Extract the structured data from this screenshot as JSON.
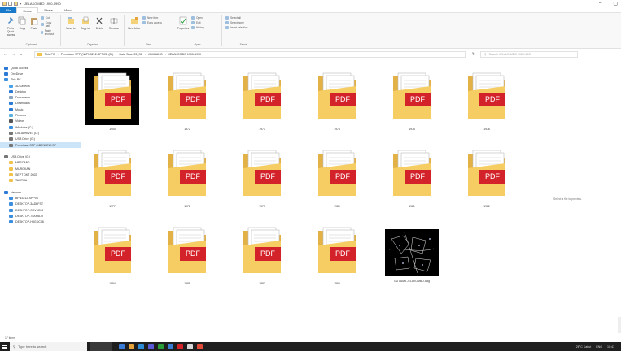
{
  "window": {
    "title": "JELAKOMBO 1900-1990",
    "minimize": "–",
    "maximize": "▢"
  },
  "ribbon_tabs": [
    "File",
    "Home",
    "Share",
    "View"
  ],
  "ribbon": {
    "clipboard": {
      "pin": "Pin to Quick access",
      "copy": "Copy",
      "paste": "Paste",
      "cut": "Cut",
      "copy_path": "Copy path",
      "paste_shortcut": "Paste shortcut",
      "group": "Clipboard"
    },
    "organize": {
      "move_to": "Move to",
      "copy_to": "Copy to",
      "delete": "Delete",
      "rename": "Rename",
      "group": "Organize"
    },
    "new": {
      "new_folder": "New folder",
      "new_item": "New item",
      "easy_access": "Easy access",
      "group": "New"
    },
    "open": {
      "properties": "Properties",
      "open": "Open",
      "edit": "Edit",
      "history": "History",
      "group": "Open"
    },
    "select": {
      "select_all": "Select all",
      "select_none": "Select none",
      "invert": "Invert selection",
      "group": "Select"
    }
  },
  "address": {
    "path": [
      "This PC",
      "Pemetaan SPP (\\\\BPN3212-SPP03) (D:)",
      "Data Scan 03_S8",
      "JOMBANG",
      "JELAKOMBO 1900-1990"
    ],
    "search_placeholder": "Search JELAKOMBO 1900-1990"
  },
  "nav_items": [
    {
      "label": "Quick access",
      "icon": "star-icon",
      "color": "#2d7ad6",
      "indent": 0
    },
    {
      "label": "OneDrive",
      "icon": "cloud-icon",
      "color": "#2d7ad6",
      "indent": 0
    },
    {
      "label": "This PC",
      "icon": "computer-icon",
      "color": "#3c8ede",
      "indent": 0
    },
    {
      "label": "3D Objects",
      "icon": "cube-icon",
      "color": "#4aa3e8",
      "indent": 1
    },
    {
      "label": "Desktop",
      "icon": "desktop-icon",
      "color": "#2d7ad6",
      "indent": 1
    },
    {
      "label": "Documents",
      "icon": "document-icon",
      "color": "#8aa4c0",
      "indent": 1
    },
    {
      "label": "Downloads",
      "icon": "download-icon",
      "color": "#2d7ad6",
      "indent": 1
    },
    {
      "label": "Music",
      "icon": "music-icon",
      "color": "#2d7ad6",
      "indent": 1
    },
    {
      "label": "Pictures",
      "icon": "picture-icon",
      "color": "#5ab0e0",
      "indent": 1
    },
    {
      "label": "Videos",
      "icon": "video-icon",
      "color": "#555555",
      "indent": 1
    },
    {
      "label": "Windows (C:)",
      "icon": "drive-icon",
      "color": "#3c8ede",
      "indent": 1
    },
    {
      "label": "DATADRIVE1 (D:)",
      "icon": "drive-icon",
      "color": "#777777",
      "indent": 1
    },
    {
      "label": "USB Drive (G:)",
      "icon": "usb-icon",
      "color": "#777777",
      "indent": 1
    },
    {
      "label": "Pemetaan SPP (\\\\BPN3212-SP",
      "icon": "network-drive-icon",
      "color": "#777777",
      "indent": 1
    },
    {
      "label": "",
      "icon": "",
      "color": "",
      "indent": 0
    },
    {
      "label": "USB Drive (G:)",
      "icon": "usb-icon",
      "color": "#777777",
      "indent": 0
    },
    {
      "label": "MPSCAN0",
      "icon": "folder-icon",
      "color": "#f1c34a",
      "indent": 1
    },
    {
      "label": "MURGKAN",
      "icon": "folder-icon",
      "color": "#f1c34a",
      "indent": 1
    },
    {
      "label": "SEPT DKT 2022",
      "icon": "folder-icon",
      "color": "#f1c34a",
      "indent": 1
    },
    {
      "label": "TAUTHA",
      "icon": "folder-icon",
      "color": "#f1c34a",
      "indent": 1
    },
    {
      "label": "",
      "icon": "",
      "color": "",
      "indent": 0
    },
    {
      "label": "Network",
      "icon": "network-icon",
      "color": "#2d7ad6",
      "indent": 0
    },
    {
      "label": "BPN3212-SPP03",
      "icon": "computer-icon",
      "color": "#3c8ede",
      "indent": 1
    },
    {
      "label": "DESKTOP-3ADLFST",
      "icon": "computer-icon",
      "color": "#3c8ede",
      "indent": 1
    },
    {
      "label": "DESKTOP-SCV6OIG",
      "icon": "computer-icon",
      "color": "#3c8ede",
      "indent": 1
    },
    {
      "label": "DESKTOP-75AR6LO",
      "icon": "computer-icon",
      "color": "#3c8ede",
      "indent": 1
    },
    {
      "label": "DESKTOP-H8GDC06",
      "icon": "computer-icon",
      "color": "#3c8ede",
      "indent": 1
    }
  ],
  "files": [
    {
      "name": "1900",
      "type": "pdf-folder",
      "selected": true
    },
    {
      "name": "1972",
      "type": "pdf-folder"
    },
    {
      "name": "1973",
      "type": "pdf-folder"
    },
    {
      "name": "1974",
      "type": "pdf-folder"
    },
    {
      "name": "1975",
      "type": "pdf-folder"
    },
    {
      "name": "1976",
      "type": "pdf-folder"
    },
    {
      "name": "1977",
      "type": "pdf-folder"
    },
    {
      "name": "1978",
      "type": "pdf-folder"
    },
    {
      "name": "1979",
      "type": "pdf-folder"
    },
    {
      "name": "1980",
      "type": "pdf-folder"
    },
    {
      "name": "1981",
      "type": "pdf-folder"
    },
    {
      "name": "1982",
      "type": "pdf-folder"
    },
    {
      "name": "1984",
      "type": "pdf-folder"
    },
    {
      "name": "1985",
      "type": "pdf-folder"
    },
    {
      "name": "1987",
      "type": "pdf-folder"
    },
    {
      "name": "1990",
      "type": "pdf-folder"
    },
    {
      "name": "GU LAMA JELAKOMBO.dwg",
      "type": "dwg-thumbnail"
    }
  ],
  "pdf_badge": "PDF",
  "preview_message": "Select a file to preview.",
  "status": {
    "count": "17 items"
  },
  "taskbar": {
    "search_placeholder": "Type here to search",
    "weather": "26°C Kabut",
    "language": "ENG",
    "time": "10:47"
  },
  "colors": {
    "accent": "#1979ca",
    "pdf_red": "#d32229",
    "folder": "#f6cd62",
    "taskbar": "#1f1f1f"
  }
}
